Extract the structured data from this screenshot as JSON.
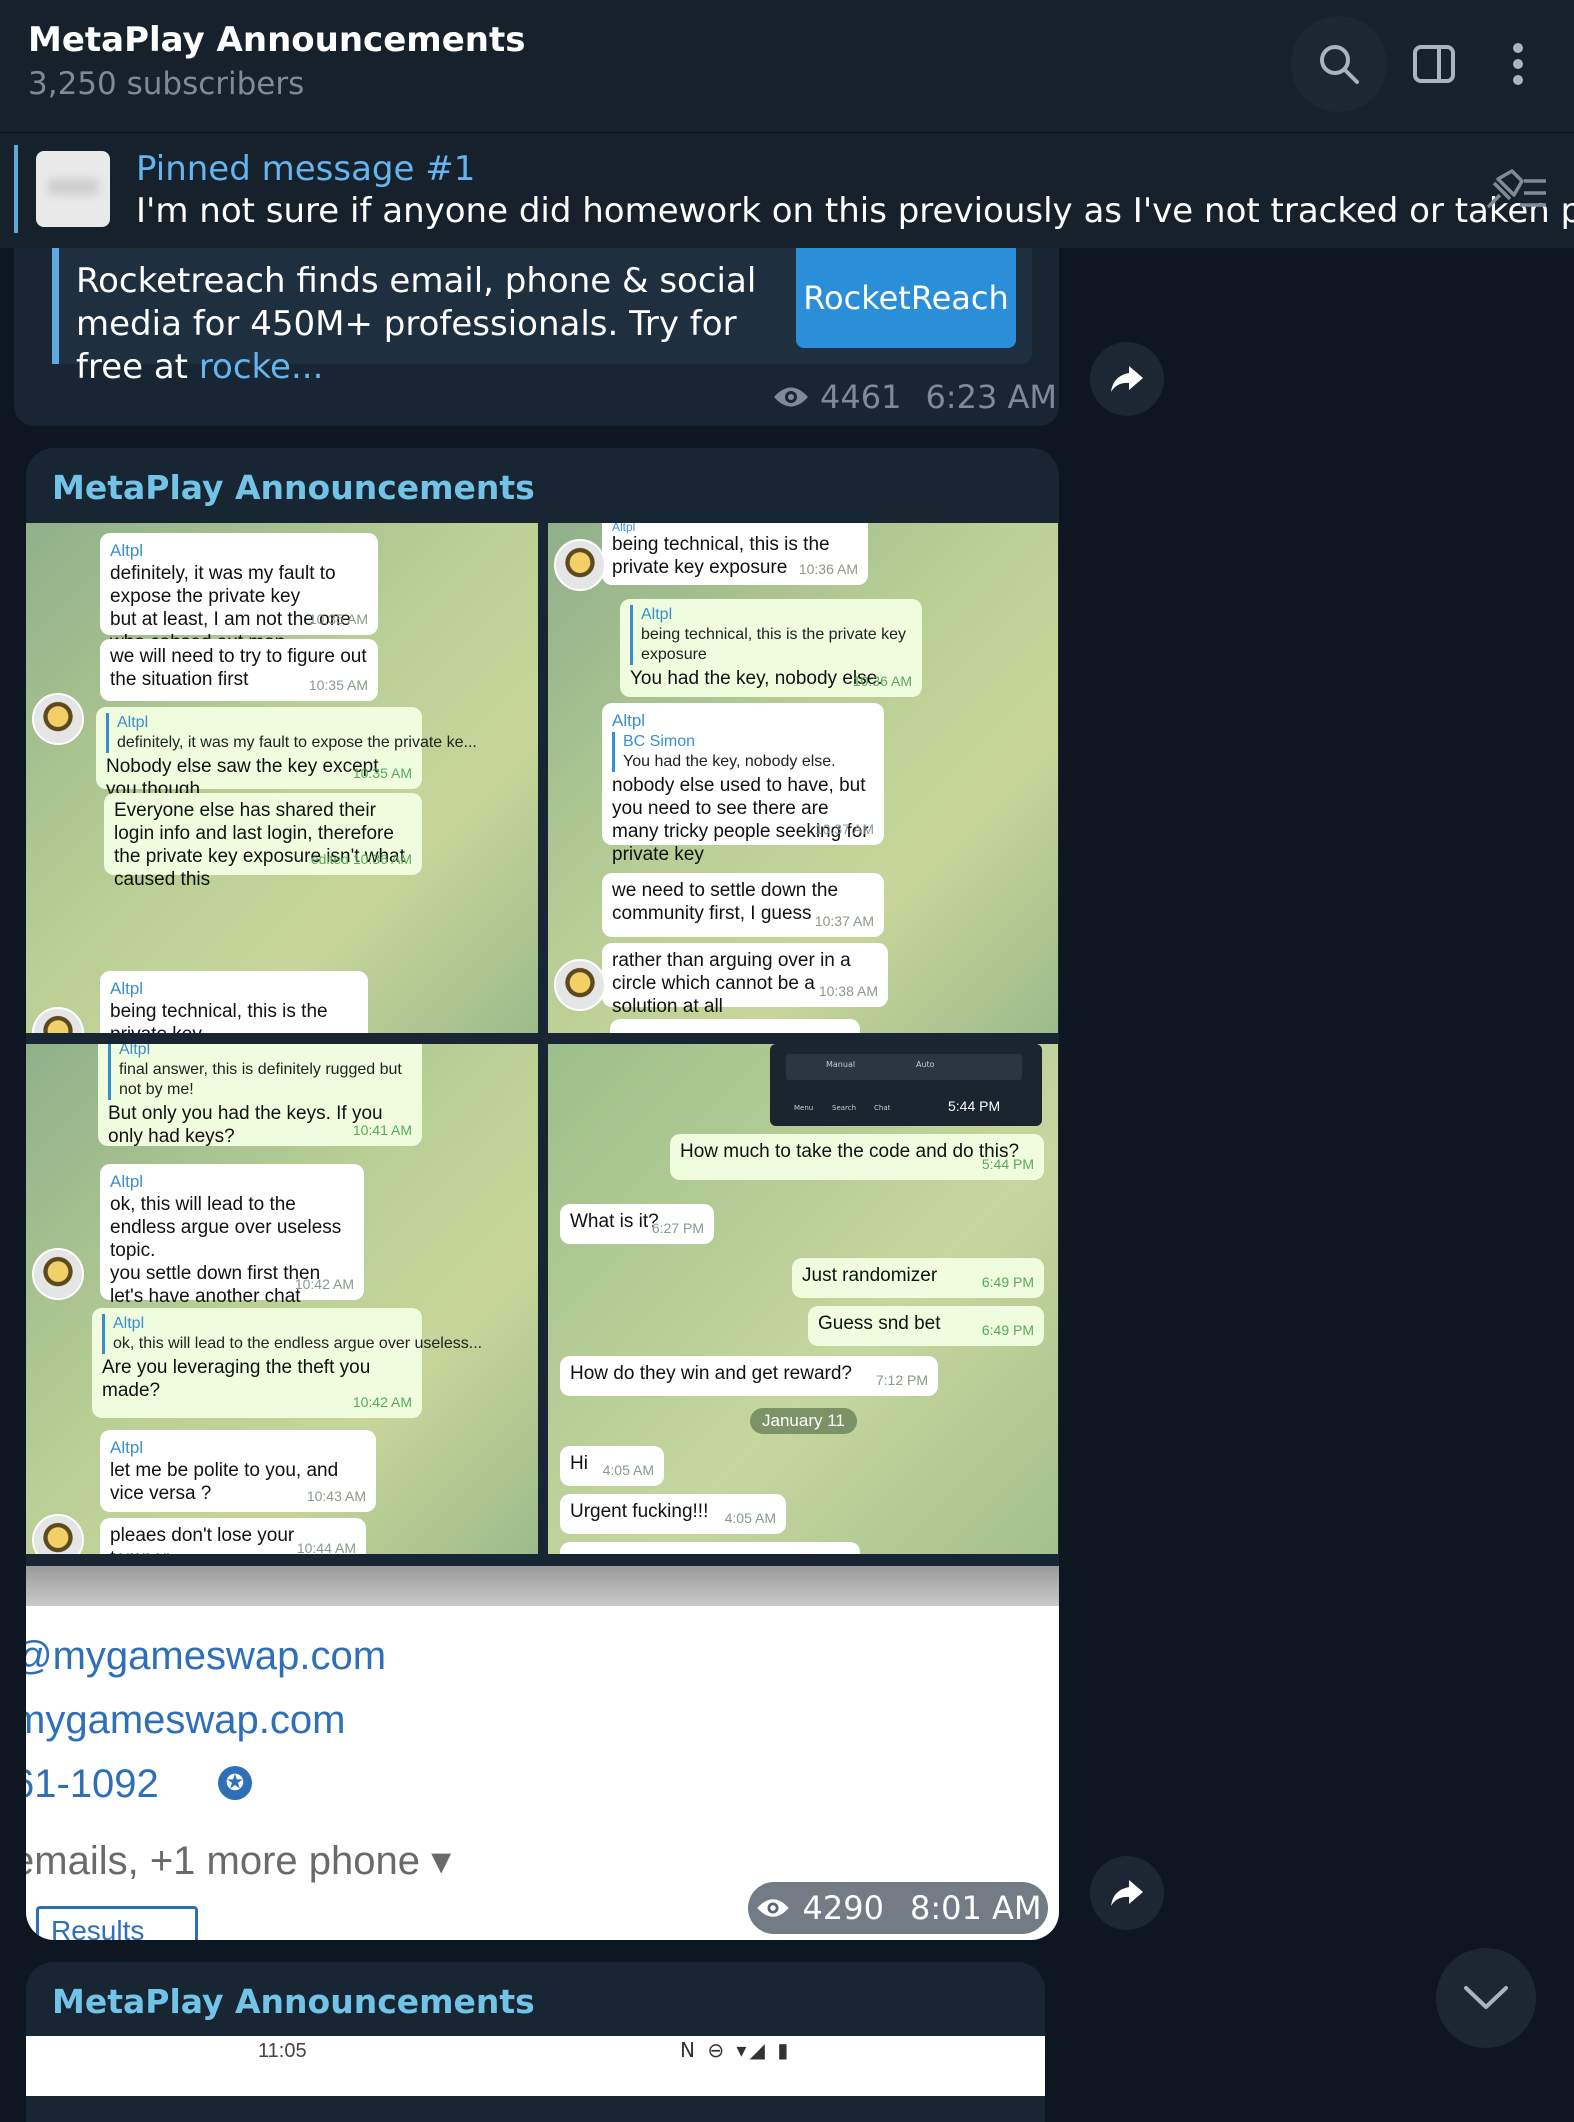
{
  "header": {
    "title": "MetaPlay Announcements",
    "subtitle": "3,250 subscribers",
    "icons": [
      "search-icon",
      "sidebar-toggle-icon",
      "more-vertical-icon"
    ]
  },
  "pinned": {
    "title": "Pinned message #1",
    "text": "I'm not sure if anyone did homework on this previously as I've not tracked or taken p..."
  },
  "post1": {
    "link_cut": "media for 450M+ professionals",
    "link_desc": "Rocketreach finds email, phone & social media for 450M+ professionals. Try for free at ",
    "link_url": "rocke...",
    "link_image_text": "RocketReach",
    "views": "4461",
    "time": "6:23 AM"
  },
  "post2": {
    "sender": "MetaPlay Announcements",
    "shot1": [
      {
        "name": "Altpl",
        "text": "definitely, it was my fault to expose the private key\nbut at least, I am not the one who cahsed out man",
        "time": "10:35 AM"
      },
      {
        "text": "we will need to try to figure out the situation first",
        "time": "10:35 AM"
      },
      {
        "quote_name": "Altpl",
        "quote": "definitely, it was my fault to expose the private ke...",
        "text": "Nobody else saw the key except you though.",
        "time": "10:35 AM"
      },
      {
        "text": "Everyone else has shared their login info and last login, therefore the private key exposure isn't what caused this",
        "time": "edited 10:36 AM"
      },
      {
        "name": "Altpl",
        "text": "being technical, this is the private key"
      }
    ],
    "shot2": [
      {
        "cut": "Altpl",
        "text": "being technical, this is the private key exposure",
        "time": "10:36 AM"
      },
      {
        "quote_name": "Altpl",
        "quote": "being technical, this is the private key exposure",
        "text": "You had the key, nobody else.",
        "time": "10:36 AM"
      },
      {
        "name": "Altpl",
        "quote_name": "BC Simon",
        "quote": "You had the key, nobody else.",
        "text": "nobody else used to have, but you need to see there are many tricky people seeking for private key",
        "time": "10:37 AM"
      },
      {
        "text": "we need to settle down the community first, I guess",
        "time": "10:37 AM"
      },
      {
        "text": "rather than arguing over in a circle which cannot be a solution at all",
        "time": "10:38 AM"
      }
    ],
    "shot3": [
      {
        "quote_name": "Altpl",
        "quote": "final answer, this is definitely rugged but not by me!",
        "text": "But only you had the keys. If you only had keys?",
        "time": "10:41 AM"
      },
      {
        "name": "Altpl",
        "text": "ok, this will lead to the endless argue over useless topic.\nyou settle down first then let's have another chat tomorrow",
        "time": "10:42 AM"
      },
      {
        "quote_name": "Altpl",
        "quote": "ok, this will lead to the endless argue over useless...",
        "text": "Are you leveraging the theft you made?",
        "time": "10:42 AM"
      },
      {
        "name": "Altpl",
        "text": "let me be polite to you, and vice versa ?",
        "time": "10:43 AM"
      },
      {
        "text": "pleaes don't lose your temper",
        "time": "10:44 AM"
      }
    ],
    "shot4": {
      "mini_tabs": [
        "Manual",
        "Auto"
      ],
      "mini_nav": [
        "Menu",
        "Search",
        "Chat"
      ],
      "mini_time": "5:44 PM",
      "messages": [
        {
          "text": "How much to take the code and do this?",
          "time": "5:44 PM"
        },
        {
          "text": "What is it?",
          "time": "6:27 PM"
        },
        {
          "text": "Just randomizer",
          "time": "6:49 PM"
        },
        {
          "text": "Guess snd bet",
          "time": "6:49 PM"
        },
        {
          "text": "How do they win and get reward?",
          "time": "7:12 PM"
        },
        {
          "date": "January 11"
        },
        {
          "text": "Hi",
          "time": "4:05 AM"
        },
        {
          "text": "Urgent fucking!!!",
          "time": "4:05 AM"
        }
      ]
    },
    "doc": {
      "line1": "@mygameswap.com",
      "line2": "mygameswap.com",
      "line3": "61-1092",
      "line4": "emails, +1 more phone ▾",
      "button": "Results"
    },
    "views": "4290",
    "time": "8:01 AM"
  },
  "post3": {
    "sender": "MetaPlay Announcements",
    "phone_time": "11:05"
  }
}
